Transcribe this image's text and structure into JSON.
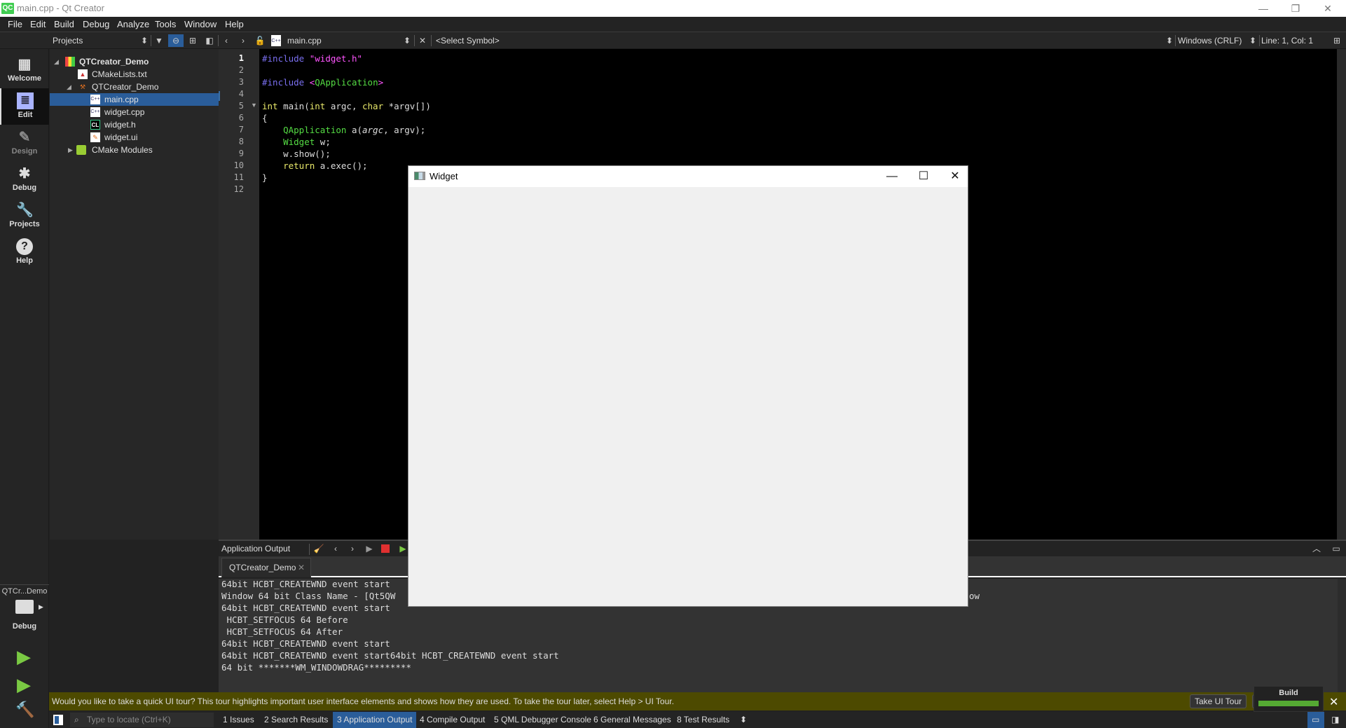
{
  "window": {
    "logo": "QC",
    "title": "main.cpp - Qt Creator",
    "controls": {
      "minimize": "—",
      "restore": "❐",
      "close": "✕"
    }
  },
  "menu": [
    "File",
    "Edit",
    "Build",
    "Debug",
    "Analyze",
    "Tools",
    "Window",
    "Help"
  ],
  "toolbar": {
    "projects_label": "Projects",
    "file_name": "main.cpp",
    "symbol": "<Select Symbol>",
    "line_ending": "Windows (CRLF)",
    "position": "Line: 1, Col: 1"
  },
  "modes": [
    {
      "label": "Welcome",
      "icon": "grid-icon"
    },
    {
      "label": "Edit",
      "icon": "edit-icon"
    },
    {
      "label": "Design",
      "icon": "pencil-icon"
    },
    {
      "label": "Debug",
      "icon": "bug-icon"
    },
    {
      "label": "Projects",
      "icon": "wrench-icon"
    },
    {
      "label": "Help",
      "icon": "help-icon"
    }
  ],
  "kit": {
    "project": "QTCr...Demo",
    "config": "Debug"
  },
  "tree": [
    {
      "label": "QTCreator_Demo",
      "level": 0,
      "type": "project",
      "expanded": true
    },
    {
      "label": "CMakeLists.txt",
      "level": 1,
      "type": "cmake"
    },
    {
      "label": "QTCreator_Demo",
      "level": 1,
      "type": "target",
      "expanded": true
    },
    {
      "label": "main.cpp",
      "level": 2,
      "type": "cpp",
      "selected": true
    },
    {
      "label": "widget.cpp",
      "level": 2,
      "type": "cpp"
    },
    {
      "label": "widget.h",
      "level": 2,
      "type": "header"
    },
    {
      "label": "widget.ui",
      "level": 2,
      "type": "ui"
    },
    {
      "label": "CMake Modules",
      "level": 1,
      "type": "modules",
      "expanded": false
    }
  ],
  "code": {
    "line_numbers": [
      "1",
      "2",
      "3",
      "4",
      "5",
      "6",
      "7",
      "8",
      "9",
      "10",
      "11",
      "12"
    ],
    "lines": [
      "#include \"widget.h\"",
      "",
      "#include <QApplication>",
      "",
      "int main(int argc, char *argv[])",
      "{",
      "    QApplication a(argc, argv);",
      "    Widget w;",
      "    w.show();",
      "    return a.exec();",
      "}",
      ""
    ]
  },
  "output": {
    "title": "Application Output",
    "tab": "QTCreator_Demo",
    "lines": [
      "64bit HCBT_CREATEWND event start",
      "Window 64 bit Class Name - [Qt5QW",
      "64bit HCBT_CREATEWND event start",
      " HCBT_SETFOCUS 64 Before",
      " HCBT_SETFOCUS 64 After",
      "64bit HCBT_CREATEWND event start",
      "64bit HCBT_CREATEWND event start64bit HCBT_CREATEWND event start",
      "64 bit *******WM_WINDOWDRAG*********"
    ],
    "overflow_fragment": "ow"
  },
  "tour": {
    "message": "Would you like to take a quick UI tour? This tour highlights important user interface elements and shows how they are used. To take the tour later, select Help > UI Tour.",
    "button": "Take UI Tour"
  },
  "build_progress": {
    "label": "Build",
    "percent": 100,
    "color": "#55aa33"
  },
  "statusbar": {
    "locator_placeholder": "Type to locate (Ctrl+K)",
    "panes": [
      "1  Issues",
      "2  Search Results",
      "3  Application Output",
      "4  Compile Output",
      "5  QML Debugger Console",
      "6  General Messages",
      "8  Test Results"
    ],
    "active_pane": 2
  },
  "widget_window": {
    "title": "Widget"
  }
}
